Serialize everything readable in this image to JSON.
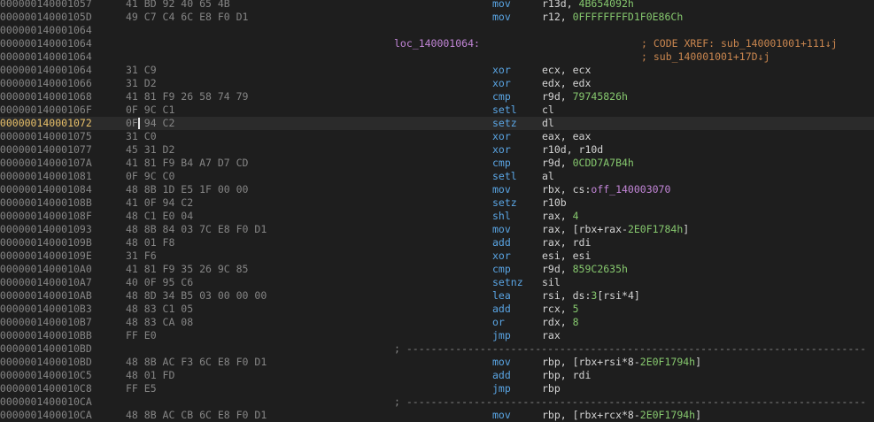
{
  "current_line_index": 9,
  "lines": [
    {
      "addr": "0000000140001057",
      "bytes": "41 BD 92 40 65 4B",
      "mnem": "mov",
      "ops": [
        {
          "t": "r13d, "
        },
        {
          "t": "4B654092h",
          "c": "imm"
        }
      ]
    },
    {
      "addr": "000000014000105D",
      "bytes": "49 C7 C4 6C E8 F0 D1",
      "mnem": "mov",
      "ops": [
        {
          "t": "r12, "
        },
        {
          "t": "0FFFFFFFFD1F0E86Ch",
          "c": "imm"
        }
      ]
    },
    {
      "addr": "0000000140001064",
      "bytes": "",
      "mnem": "",
      "ops": []
    },
    {
      "addr": "0000000140001064",
      "bytes": "",
      "label": "loc_140001064:",
      "comment": "; CODE XREF: sub_140001001+111↓j",
      "mnem": "",
      "ops": []
    },
    {
      "addr": "0000000140001064",
      "bytes": "",
      "comment": "; sub_140001001+17D↓j",
      "mnem": "",
      "ops": []
    },
    {
      "addr": "0000000140001064",
      "bytes": "31 C9",
      "mnem": "xor",
      "ops": [
        {
          "t": "ecx, ecx"
        }
      ]
    },
    {
      "addr": "0000000140001066",
      "bytes": "31 D2",
      "mnem": "xor",
      "ops": [
        {
          "t": "edx, edx"
        }
      ]
    },
    {
      "addr": "0000000140001068",
      "bytes": "41 81 F9 26 58 74 79",
      "mnem": "cmp",
      "ops": [
        {
          "t": "r9d, "
        },
        {
          "t": "79745826h",
          "c": "imm"
        }
      ]
    },
    {
      "addr": "000000014000106F",
      "bytes": "0F 9C C1",
      "mnem": "setl",
      "ops": [
        {
          "t": "cl"
        }
      ]
    },
    {
      "addr": "0000000140001072",
      "bytes": "0F 94 C2",
      "mnem": "setz",
      "ops": [
        {
          "t": "dl"
        }
      ]
    },
    {
      "addr": "0000000140001075",
      "bytes": "31 C0",
      "mnem": "xor",
      "ops": [
        {
          "t": "eax, eax"
        }
      ]
    },
    {
      "addr": "0000000140001077",
      "bytes": "45 31 D2",
      "mnem": "xor",
      "ops": [
        {
          "t": "r10d, r10d"
        }
      ]
    },
    {
      "addr": "000000014000107A",
      "bytes": "41 81 F9 B4 A7 D7 CD",
      "mnem": "cmp",
      "ops": [
        {
          "t": "r9d, "
        },
        {
          "t": "0CDD7A7B4h",
          "c": "imm"
        }
      ]
    },
    {
      "addr": "0000000140001081",
      "bytes": "0F 9C C0",
      "mnem": "setl",
      "ops": [
        {
          "t": "al"
        }
      ]
    },
    {
      "addr": "0000000140001084",
      "bytes": "48 8B 1D E5 1F 00 00",
      "mnem": "mov",
      "ops": [
        {
          "t": "rbx, cs:"
        },
        {
          "t": "off_140003070",
          "c": "sym"
        }
      ]
    },
    {
      "addr": "000000014000108B",
      "bytes": "41 0F 94 C2",
      "mnem": "setz",
      "ops": [
        {
          "t": "r10b"
        }
      ]
    },
    {
      "addr": "000000014000108F",
      "bytes": "48 C1 E0 04",
      "mnem": "shl",
      "ops": [
        {
          "t": "rax, "
        },
        {
          "t": "4",
          "c": "imm"
        }
      ]
    },
    {
      "addr": "0000000140001093",
      "bytes": "48 8B 84 03 7C E8 F0 D1",
      "mnem": "mov",
      "ops": [
        {
          "t": "rax, [rbx+rax-"
        },
        {
          "t": "2E0F1784h",
          "c": "imm"
        },
        {
          "t": "]"
        }
      ]
    },
    {
      "addr": "000000014000109B",
      "bytes": "48 01 F8",
      "mnem": "add",
      "ops": [
        {
          "t": "rax, rdi"
        }
      ]
    },
    {
      "addr": "000000014000109E",
      "bytes": "31 F6",
      "mnem": "xor",
      "ops": [
        {
          "t": "esi, esi"
        }
      ]
    },
    {
      "addr": "00000001400010A0",
      "bytes": "41 81 F9 35 26 9C 85",
      "mnem": "cmp",
      "ops": [
        {
          "t": "r9d, "
        },
        {
          "t": "859C2635h",
          "c": "imm"
        }
      ]
    },
    {
      "addr": "00000001400010A7",
      "bytes": "40 0F 95 C6",
      "mnem": "setnz",
      "ops": [
        {
          "t": "sil"
        }
      ]
    },
    {
      "addr": "00000001400010AB",
      "bytes": "48 8D 34 B5 03 00 00 00",
      "mnem": "lea",
      "ops": [
        {
          "t": "rsi, ds:"
        },
        {
          "t": "3",
          "c": "imm"
        },
        {
          "t": "[rsi*4]"
        }
      ]
    },
    {
      "addr": "00000001400010B3",
      "bytes": "48 83 C1 05",
      "mnem": "add",
      "ops": [
        {
          "t": "rcx, "
        },
        {
          "t": "5",
          "c": "imm"
        }
      ]
    },
    {
      "addr": "00000001400010B7",
      "bytes": "48 83 CA 08",
      "mnem": "or",
      "ops": [
        {
          "t": "rdx, "
        },
        {
          "t": "8",
          "c": "imm"
        }
      ]
    },
    {
      "addr": "00000001400010BB",
      "bytes": "FF E0",
      "mnem": "jmp",
      "ops": [
        {
          "t": "rax"
        }
      ]
    },
    {
      "addr": "00000001400010BD",
      "bytes": "",
      "sep": "; ---------------------------------------------------------------------------",
      "mnem": "",
      "ops": []
    },
    {
      "addr": "00000001400010BD",
      "bytes": "48 8B AC F3 6C E8 F0 D1",
      "mnem": "mov",
      "ops": [
        {
          "t": "rbp, [rbx+rsi*8-"
        },
        {
          "t": "2E0F1794h",
          "c": "imm"
        },
        {
          "t": "]"
        }
      ]
    },
    {
      "addr": "00000001400010C5",
      "bytes": "48 01 FD",
      "mnem": "add",
      "ops": [
        {
          "t": "rbp, rdi"
        }
      ]
    },
    {
      "addr": "00000001400010C8",
      "bytes": "FF E5",
      "mnem": "jmp",
      "ops": [
        {
          "t": "rbp"
        }
      ]
    },
    {
      "addr": "00000001400010CA",
      "bytes": "",
      "sep": "; ---------------------------------------------------------------------------",
      "mnem": "",
      "ops": []
    },
    {
      "addr": "00000001400010CA",
      "bytes": "48 8B AC CB 6C E8 F0 D1",
      "mnem": "mov",
      "ops": [
        {
          "t": "rbp, [rbx+rcx*8-"
        },
        {
          "t": "2E0F1794h",
          "c": "imm"
        },
        {
          "t": "]"
        }
      ]
    }
  ]
}
